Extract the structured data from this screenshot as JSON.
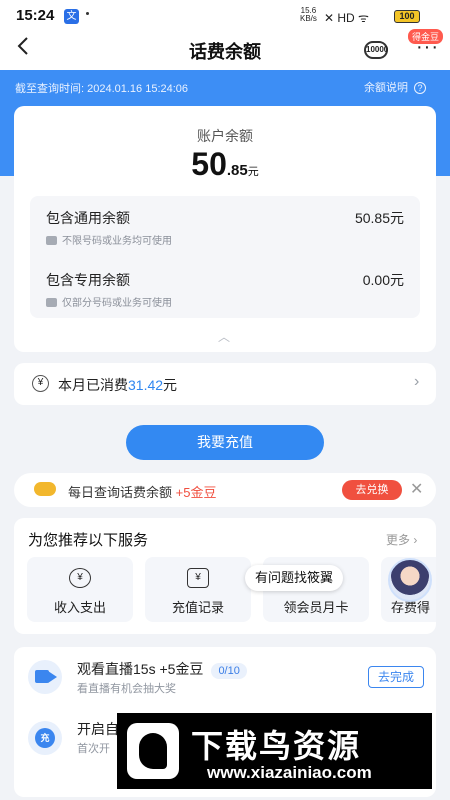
{
  "status_bar": {
    "time": "15:24",
    "app_icon": "文",
    "net_speed_value": "15.6",
    "net_speed_unit": "KB/s",
    "signal_text": "✕ HD ᯤ",
    "battery": "100"
  },
  "nav": {
    "back_icon": "chevron-left-icon",
    "title": "话费余额",
    "hotline": "10000",
    "more_icon": "more-icon",
    "gold_badge": "得金豆"
  },
  "header": {
    "query_time": "截至查询时间: 2024.01.16 15:24:06",
    "explain": "余额说明",
    "explain_icon": "?"
  },
  "balance": {
    "label": "账户余额",
    "integer": "50",
    "decimal": ".85",
    "unit": "元",
    "rows": [
      {
        "title": "包含通用余额",
        "amount": "50.85元",
        "note": "不限号码或业务均可使用"
      },
      {
        "title": "包含专用余额",
        "amount": "0.00元",
        "note": "仅部分号码或业务可使用"
      }
    ],
    "collapse_icon": "︿"
  },
  "month": {
    "yen": "¥",
    "prefix": "本月已消费",
    "amount": "31.42",
    "suffix": "元",
    "chevron": "›"
  },
  "recharge_button": "我要充值",
  "daily": {
    "text": "每日查询话费余额",
    "reward": "+5金豆",
    "button": "去兑换",
    "close": "✕"
  },
  "services": {
    "title": "为您推荐以下服务",
    "more": "更多 ›",
    "tiles": [
      {
        "label": "收入支出",
        "icon": "¥"
      },
      {
        "label": "充值记录",
        "icon": "¥"
      },
      {
        "label": "领会员月卡",
        "icon": ""
      },
      {
        "label": "存费得",
        "icon": ""
      }
    ],
    "bubble": "有问题找筱翼"
  },
  "tasks": [
    {
      "title": "观看直播15s +5金豆",
      "progress": "0/10",
      "subtitle": "看直播有机会抽大奖",
      "button": "去完成"
    },
    {
      "title": "开启自",
      "icon_text": "充",
      "subtitle": "首次开"
    }
  ],
  "watermark": {
    "title": "下载鸟资源",
    "url": "www.xiazainiao.com"
  }
}
